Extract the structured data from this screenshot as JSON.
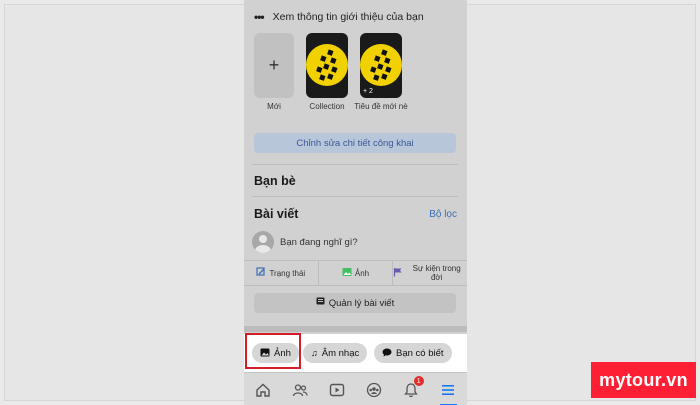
{
  "about": {
    "dots": "•••",
    "text": "Xem thông tin giới thiệu của bạn"
  },
  "highlights": {
    "new_label": "Mới",
    "new_plus": "+",
    "items": [
      {
        "label": "Collection"
      },
      {
        "label": "Tiêu đề mới nè",
        "count": "+ 2"
      }
    ]
  },
  "edit_public": "Chỉnh sửa chi tiết công khai",
  "friends_title": "Bạn bè",
  "posts": {
    "title": "Bài viết",
    "filter": "Bộ lọc",
    "composer_placeholder": "Bạn đang nghĩ gì?"
  },
  "actions": [
    {
      "icon": "edit-icon",
      "label": "Trạng thái"
    },
    {
      "icon": "photo-icon",
      "label": "Ảnh"
    },
    {
      "icon": "flag-icon",
      "label": "Sự kiện trong đời"
    }
  ],
  "manage_posts": "Quản lý bài viết",
  "chips": [
    {
      "icon": "photo-icon",
      "label": "Ảnh"
    },
    {
      "icon": "music-note-icon",
      "label": "Âm nhạc"
    },
    {
      "icon": "speech-bubble-icon",
      "label": "Bạn có biết"
    }
  ],
  "bottom_nav": {
    "items": [
      "home-icon",
      "friends-icon",
      "video-icon",
      "groups-icon",
      "bell-icon",
      "menu-icon"
    ],
    "notification_count": "1",
    "active": "menu-icon"
  },
  "watermark": "mytour.vn",
  "colors": {
    "accent": "#1877f2",
    "highlight_box": "#d51d2a",
    "watermark_bg": "#ff1f35"
  }
}
